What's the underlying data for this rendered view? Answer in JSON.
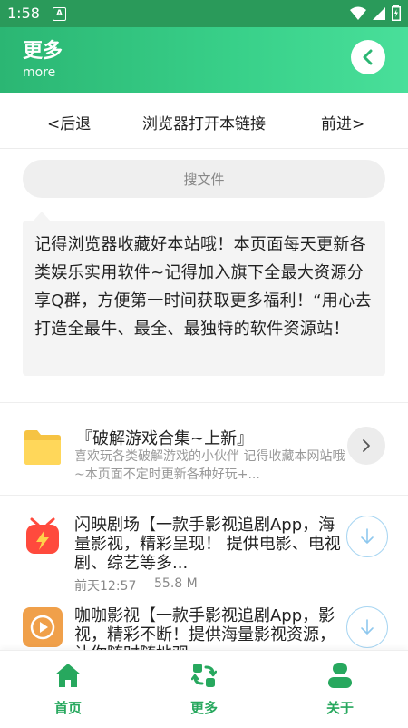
{
  "statusbar": {
    "time": "1:58",
    "sim_label": "A"
  },
  "header": {
    "title": "更多",
    "subtitle": "more"
  },
  "nav": {
    "back": "<后退",
    "open_in_browser": "浏览器打开本链接",
    "forward": "前进>"
  },
  "search": {
    "placeholder": "搜文件"
  },
  "notice": {
    "text": "记得浏览器收藏好本站哦！本页面每天更新各类娱乐实用软件~记得加入旗下全最大资源分享Q群，方便第一时间获取更多福利！“用心去打造全最牛、最全、最独特的软件资源站！"
  },
  "folder": {
    "title": "『破解游戏合集~上新』",
    "desc": "喜欢玩各类破解游戏的小伙伴 记得收藏本网站哦~本页面不定时更新各种好玩+..."
  },
  "files": [
    {
      "title": "闪映剧场【一款手影视追剧App，海量影视，精彩呈现！ 提供电影、电视剧、综艺等多...",
      "date": "前天12:57",
      "size": "55.8 M"
    },
    {
      "title": "咖咖影视【一款手影视追剧App，影视，精彩不断！提供海量影视资源，让你随时随地观"
    }
  ],
  "tabs": [
    {
      "label": "首页",
      "icon": "home-icon"
    },
    {
      "label": "更多",
      "icon": "more-icon"
    },
    {
      "label": "关于",
      "icon": "user-icon"
    }
  ],
  "colors": {
    "accent": "#27a85e",
    "header_start": "#2bb673",
    "header_end": "#49df9a",
    "statusbar": "#2a9a5a"
  }
}
